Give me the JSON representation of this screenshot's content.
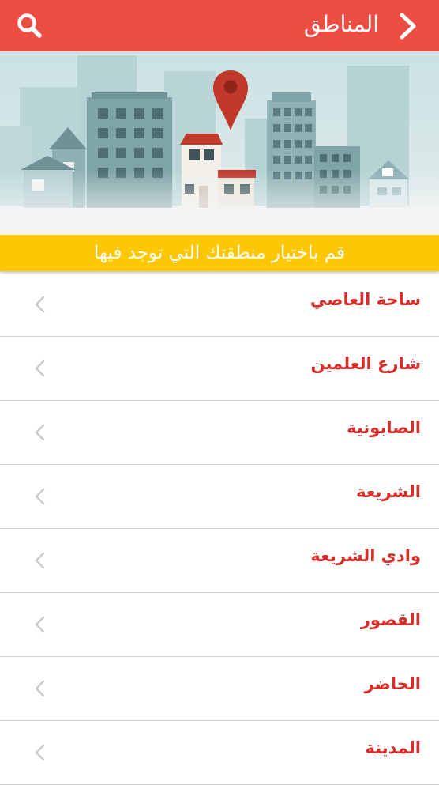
{
  "header": {
    "title": "المناطق",
    "back_icon": "chevron-right-icon",
    "search_icon": "search-icon",
    "bg_color": "#ee4d44"
  },
  "banner": {
    "prompt": "قم باختيار منطقتك التي توجد فيها",
    "prompt_bg": "#fdc702",
    "illustration": "city-map-pin-illustration"
  },
  "areas": [
    {
      "label": "ساحة العاصي"
    },
    {
      "label": "شارع العلمين"
    },
    {
      "label": "الصابونية"
    },
    {
      "label": "الشريعة"
    },
    {
      "label": "وادي الشريعة"
    },
    {
      "label": "القصور"
    },
    {
      "label": "الحاضر"
    },
    {
      "label": "المدينة"
    }
  ],
  "colors": {
    "item_text": "#d42f2b",
    "divider": "#cfcfcf",
    "chevron": "#cccccc"
  }
}
